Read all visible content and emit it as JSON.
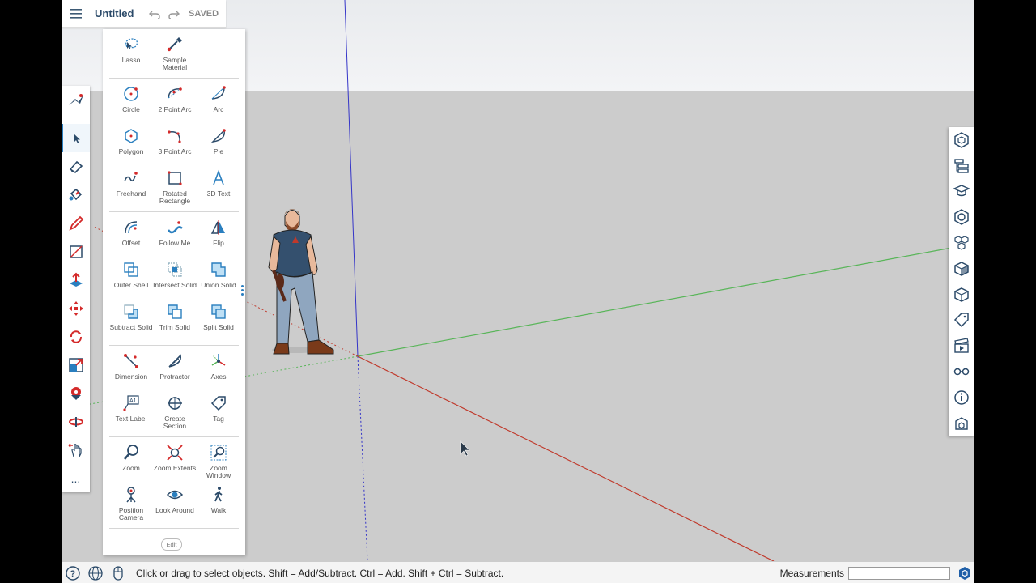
{
  "colors": {
    "accent": "#2a7fbf",
    "tool_red": "#d42a2a",
    "axis_red": "#c0392b",
    "axis_green": "#5cb85c",
    "axis_blue": "#3030c0"
  },
  "header": {
    "title": "Untitled",
    "saved": "SAVED",
    "icons": [
      "menu-icon",
      "undo-icon",
      "redo-icon"
    ]
  },
  "left_toolbar": {
    "icons": [
      "search-tool-icon",
      "select-icon",
      "eraser-icon",
      "paint-bucket-icon",
      "pencil-icon",
      "rectangle-icon",
      "push-pull-icon",
      "move-icon",
      "rotate-icon",
      "scale-icon",
      "tape-measure-icon",
      "orbit-icon",
      "pan-icon"
    ],
    "more": "..."
  },
  "tool_panel": {
    "groups": [
      [
        {
          "label": "Lasso",
          "icon": "lasso-icon"
        },
        {
          "label": "Sample Material",
          "icon": "sample-material-icon"
        }
      ],
      [
        {
          "label": "Circle",
          "icon": "circle-icon"
        },
        {
          "label": "2 Point Arc",
          "icon": "two-point-arc-icon"
        },
        {
          "label": "Arc",
          "icon": "arc-icon"
        },
        {
          "label": "Polygon",
          "icon": "polygon-icon"
        },
        {
          "label": "3 Point Arc",
          "icon": "three-point-arc-icon"
        },
        {
          "label": "Pie",
          "icon": "pie-icon"
        },
        {
          "label": "Freehand",
          "icon": "freehand-icon"
        },
        {
          "label": "Rotated Rectangle",
          "icon": "rotated-rectangle-icon"
        },
        {
          "label": "3D Text",
          "icon": "3d-text-icon"
        }
      ],
      [
        {
          "label": "Offset",
          "icon": "offset-icon"
        },
        {
          "label": "Follow Me",
          "icon": "follow-me-icon"
        },
        {
          "label": "Flip",
          "icon": "flip-icon"
        },
        {
          "label": "Outer Shell",
          "icon": "outer-shell-icon"
        },
        {
          "label": "Intersect Solid",
          "icon": "intersect-solid-icon"
        },
        {
          "label": "Union Solid",
          "icon": "union-solid-icon"
        },
        {
          "label": "Subtract Solid",
          "icon": "subtract-solid-icon"
        },
        {
          "label": "Trim Solid",
          "icon": "trim-solid-icon"
        },
        {
          "label": "Split Solid",
          "icon": "split-solid-icon"
        }
      ],
      [
        {
          "label": "Dimension",
          "icon": "dimension-icon"
        },
        {
          "label": "Protractor",
          "icon": "protractor-icon"
        },
        {
          "label": "Axes",
          "icon": "axes-icon"
        },
        {
          "label": "Text Label",
          "icon": "text-label-icon"
        },
        {
          "label": "Create Section",
          "icon": "create-section-icon"
        },
        {
          "label": "Tag",
          "icon": "tag-icon"
        }
      ],
      [
        {
          "label": "Zoom",
          "icon": "zoom-icon"
        },
        {
          "label": "Zoom Extents",
          "icon": "zoom-extents-icon"
        },
        {
          "label": "Zoom Window",
          "icon": "zoom-window-icon"
        },
        {
          "label": "Position Camera",
          "icon": "position-camera-icon"
        },
        {
          "label": "Look Around",
          "icon": "look-around-icon"
        },
        {
          "label": "Walk",
          "icon": "walk-icon"
        }
      ]
    ],
    "edit_label": "Edit"
  },
  "right_panel": {
    "icons": [
      "entity-info-icon",
      "outliner-icon",
      "instructor-icon",
      "materials-icon",
      "components-icon",
      "styles-icon",
      "solid-inspector-icon",
      "tags-icon",
      "scenes-icon",
      "display-icon",
      "model-info-icon",
      "3d-warehouse-icon"
    ]
  },
  "status_bar": {
    "icons": [
      "help-icon",
      "globe-icon",
      "mouse-icon"
    ],
    "text": "Click or drag to select objects. Shift = Add/Subtract. Ctrl = Add. Shift + Ctrl = Subtract.",
    "measurements_label": "Measurements",
    "measurements_value": ""
  }
}
